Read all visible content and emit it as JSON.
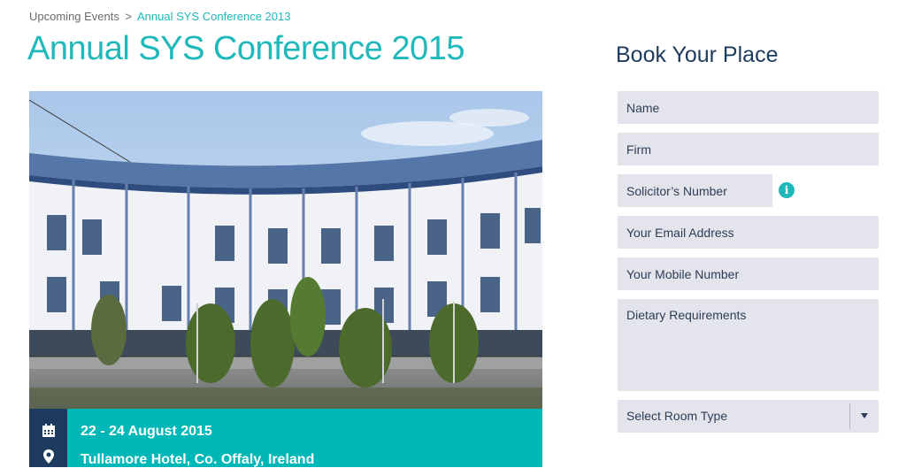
{
  "breadcrumb": {
    "parent": "Upcoming Events",
    "separator": ">",
    "current": "Annual SYS Conference 2013"
  },
  "page_title": "Annual SYS Conference 2015",
  "event": {
    "dates": "22 - 24 August 2015",
    "location": "Tullamore Hotel, Co. Offaly, Ireland",
    "icons": [
      "calendar-icon",
      "map-pin-icon"
    ]
  },
  "booking": {
    "title": "Book Your Place",
    "fields": {
      "name": "Name",
      "firm": "Firm",
      "solicitor_number": "Solicitor’s Number",
      "email": "Your Email Address",
      "mobile": "Your Mobile Number",
      "dietary": "Dietary Requirements"
    },
    "info_icon_glyph": "i",
    "room_type": "Select Room Type"
  },
  "colors": {
    "accent": "#1fb9bb",
    "navy": "#1c3b5f",
    "strip": "#00b7b8",
    "field_bg": "#e4e4ec"
  }
}
